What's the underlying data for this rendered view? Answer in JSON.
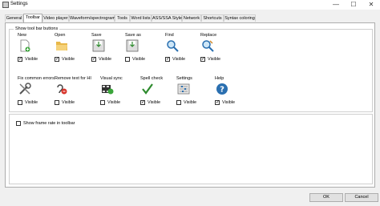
{
  "window": {
    "title": "Settings",
    "min": "—",
    "max": "☐",
    "close": "✕"
  },
  "tabs": [
    "General",
    "Toolbar",
    "Video player",
    "Waveform/spectrogram",
    "Tools",
    "Word lists",
    "ASS/SSA Style",
    "Network",
    "Shortcuts",
    "Syntax coloring"
  ],
  "active_tab": "Toolbar",
  "toolbar_group": {
    "title": "Show tool bar buttons"
  },
  "tools": [
    {
      "label": "New",
      "checked": true,
      "check_label": "Visible",
      "icon": "new-icon"
    },
    {
      "label": "Open",
      "checked": true,
      "check_label": "Visible",
      "icon": "folder-open-icon"
    },
    {
      "label": "Save",
      "checked": true,
      "check_label": "Visible",
      "icon": "save-icon"
    },
    {
      "label": "Save as",
      "checked": false,
      "check_label": "Visible",
      "icon": "save-as-icon"
    },
    {
      "label": "Find",
      "checked": true,
      "check_label": "Visible",
      "icon": "find-icon"
    },
    {
      "label": "Replace",
      "checked": true,
      "check_label": "Visible",
      "icon": "replace-icon"
    },
    {
      "label": "Fix common errors",
      "checked": false,
      "check_label": "Visible",
      "icon": "fix-errors-icon"
    },
    {
      "label": "Remove text for HI",
      "checked": false,
      "check_label": "Visible",
      "icon": "remove-hi-icon"
    },
    {
      "label": "Visual sync",
      "checked": false,
      "check_label": "Visible",
      "icon": "visual-sync-icon"
    },
    {
      "label": "Spell check",
      "checked": true,
      "check_label": "Visible",
      "icon": "spell-check-icon"
    },
    {
      "label": "Settings",
      "checked": false,
      "check_label": "Visible",
      "icon": "settings-icon"
    },
    {
      "label": "Help",
      "checked": true,
      "check_label": "Visible",
      "icon": "help-icon"
    }
  ],
  "frame_rate": {
    "label": "Show frame rate in toolbar",
    "checked": false
  },
  "buttons": {
    "ok": "OK",
    "cancel": "Cancel"
  }
}
